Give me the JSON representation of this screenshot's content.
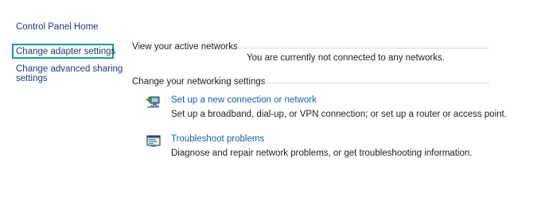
{
  "sidebar": {
    "home": "Control Panel Home",
    "links": [
      {
        "label": "Change adapter settings"
      },
      {
        "label": "Change advanced sharing"
      },
      {
        "label": "settings"
      }
    ]
  },
  "active_networks": {
    "title": "View your active networks",
    "status": "You are currently not connected to any networks."
  },
  "networking_settings": {
    "title": "Change your networking settings",
    "tasks": [
      {
        "icon": "network-setup-icon",
        "link": "Set up a new connection or network",
        "desc": "Set up a broadband, dial-up, or VPN connection; or set up a router or access point."
      },
      {
        "icon": "troubleshoot-icon",
        "link": "Troubleshoot problems",
        "desc": "Diagnose and repair network problems, or get troubleshooting information."
      }
    ]
  },
  "colors": {
    "highlight": "#1b9a8e",
    "link": "#1861a8",
    "nav_link": "#1a3b7e"
  }
}
